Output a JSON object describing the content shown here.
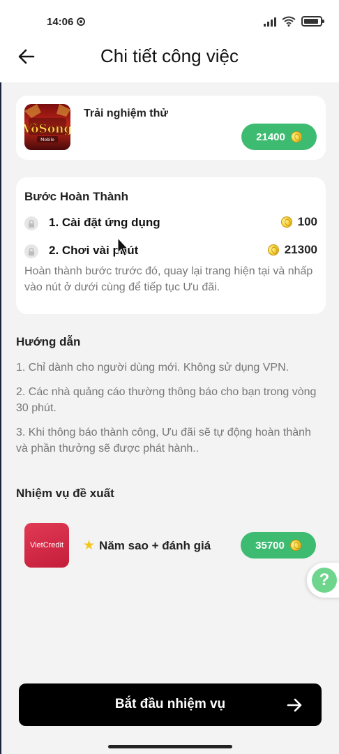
{
  "status_bar": {
    "time": "14:06"
  },
  "header": {
    "title": "Chi tiết công việc"
  },
  "game": {
    "title": "Trải nghiệm thử",
    "thumb_text": "VõSong",
    "thumb_sub": "Mobile",
    "reward": "21400"
  },
  "steps": {
    "title": "Bước Hoàn Thành",
    "items": [
      {
        "label": "1. Cài đặt ứng dụng",
        "reward": "100"
      },
      {
        "label": "2. Chơi vài phút",
        "reward": "21300"
      }
    ],
    "note": "Hoàn thành bước trước đó, quay lại trang hiện tại và nhấp vào nút ở dưới cùng để tiếp tục Ưu đãi."
  },
  "guide": {
    "title": "Hướng dẫn",
    "items": [
      "1. Chỉ dành cho người dùng mới. Không sử dụng VPN.",
      "2. Các nhà quảng cáo thường thông báo cho bạn trong vòng 30 phút.",
      "3. Khi thông báo thành công, Ưu đãi sẽ tự động hoàn thành và phần thưởng sẽ được phát hành.."
    ]
  },
  "recommended": {
    "title": "Nhiệm vụ đề xuất",
    "item": {
      "logo_text": "VietCredit",
      "label": "Năm sao + đánh giá",
      "reward": "35700"
    }
  },
  "help": {
    "symbol": "?"
  },
  "cta": {
    "label": "Bắt đầu nhiệm vụ"
  },
  "colors": {
    "accent_green": "#3dbb71",
    "cta_black": "#000000",
    "help_green": "#6ed58d",
    "coin_gold": "#f5d43c"
  },
  "icons": {
    "back": "arrow-left-icon",
    "coin": "coin-icon",
    "lock": "lock-icon",
    "star": "star-icon",
    "help": "question-icon",
    "cta_arrow": "arrow-right-icon"
  }
}
